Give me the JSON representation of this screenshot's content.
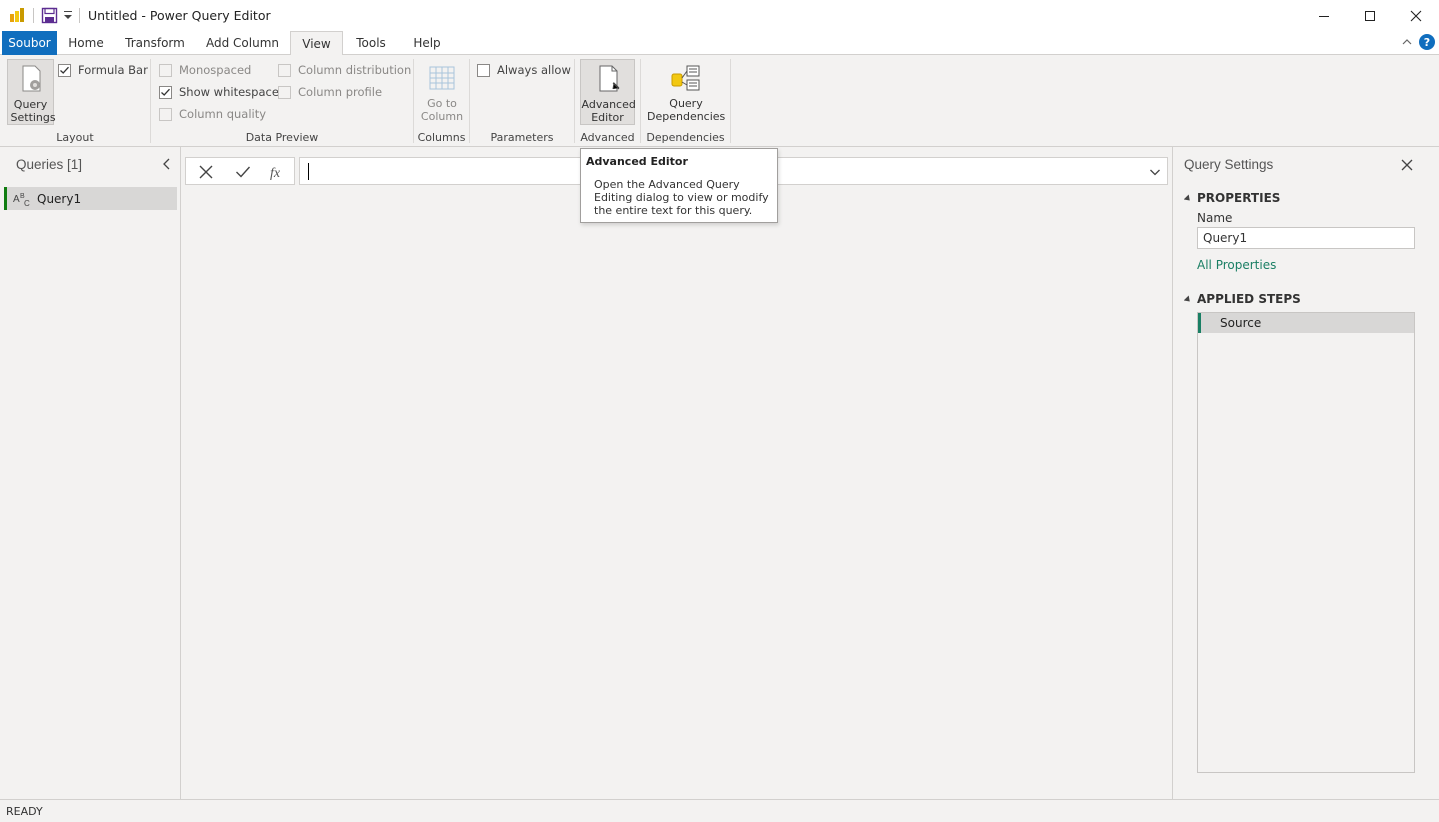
{
  "window": {
    "title": "Untitled - Power Query Editor"
  },
  "tabs": [
    {
      "label": "Soubor"
    },
    {
      "label": "Home"
    },
    {
      "label": "Transform"
    },
    {
      "label": "Add Column"
    },
    {
      "label": "View"
    },
    {
      "label": "Tools"
    },
    {
      "label": "Help"
    }
  ],
  "active_tab": "View",
  "ribbon": {
    "layout": {
      "label": "Layout",
      "query_settings": "Query Settings",
      "formula_bar": {
        "label": "Formula Bar",
        "checked": true
      }
    },
    "data_preview": {
      "label": "Data Preview",
      "monospaced": {
        "label": "Monospaced",
        "checked": false
      },
      "show_whitespace": {
        "label": "Show whitespace",
        "checked": true
      },
      "column_quality": {
        "label": "Column quality",
        "checked": false
      },
      "column_distribution": {
        "label": "Column distribution",
        "checked": false
      },
      "column_profile": {
        "label": "Column profile",
        "checked": false
      }
    },
    "columns": {
      "label": "Columns",
      "go_to_column": "Go to Column"
    },
    "parameters": {
      "label": "Parameters",
      "always_allow": {
        "label": "Always allow",
        "checked": false
      }
    },
    "advanced": {
      "label": "Advanced",
      "advanced_editor": "Advanced Editor"
    },
    "dependencies": {
      "label": "Dependencies",
      "query_dependencies": "Query Dependencies"
    }
  },
  "queries_pane": {
    "title": "Queries [1]",
    "items": [
      {
        "label": "Query1"
      }
    ]
  },
  "formula_bar": {
    "value": ""
  },
  "tooltip": {
    "title": "Advanced Editor",
    "body": "Open the Advanced Query Editing dialog to view or modify the entire text for this query."
  },
  "settings_pane": {
    "title": "Query Settings",
    "properties_heading": "PROPERTIES",
    "name_label": "Name",
    "name_value": "Query1",
    "all_properties": "All Properties",
    "applied_steps_heading": "APPLIED STEPS",
    "steps": [
      {
        "label": "Source"
      }
    ]
  },
  "status": {
    "text": "READY"
  },
  "colors": {
    "file_tab": "#106ebe",
    "accent_green": "#1a7f64",
    "background": "#f3f2f1"
  }
}
